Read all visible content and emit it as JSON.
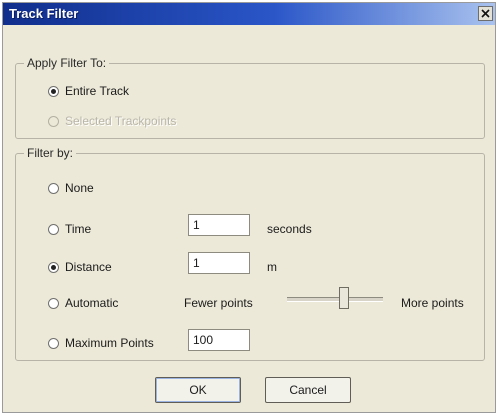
{
  "window": {
    "title": "Track Filter",
    "close_icon": "close-icon"
  },
  "apply_group": {
    "label": "Apply Filter To:",
    "options": [
      {
        "label": "Entire Track",
        "checked": true,
        "disabled": false
      },
      {
        "label": "Selected Trackpoints",
        "checked": false,
        "disabled": true
      }
    ]
  },
  "filter_group": {
    "label": "Filter by:",
    "none": {
      "label": "None",
      "checked": false
    },
    "time": {
      "label": "Time",
      "checked": false,
      "value": "1",
      "unit": "seconds"
    },
    "distance": {
      "label": "Distance",
      "checked": true,
      "value": "1",
      "unit": "m"
    },
    "automatic": {
      "label": "Automatic",
      "checked": false,
      "fewer_label": "Fewer points",
      "more_label": "More points",
      "slider_level": 0.6
    },
    "max_points": {
      "label": "Maximum Points",
      "checked": false,
      "value": "100"
    }
  },
  "buttons": {
    "ok": "OK",
    "cancel": "Cancel"
  }
}
